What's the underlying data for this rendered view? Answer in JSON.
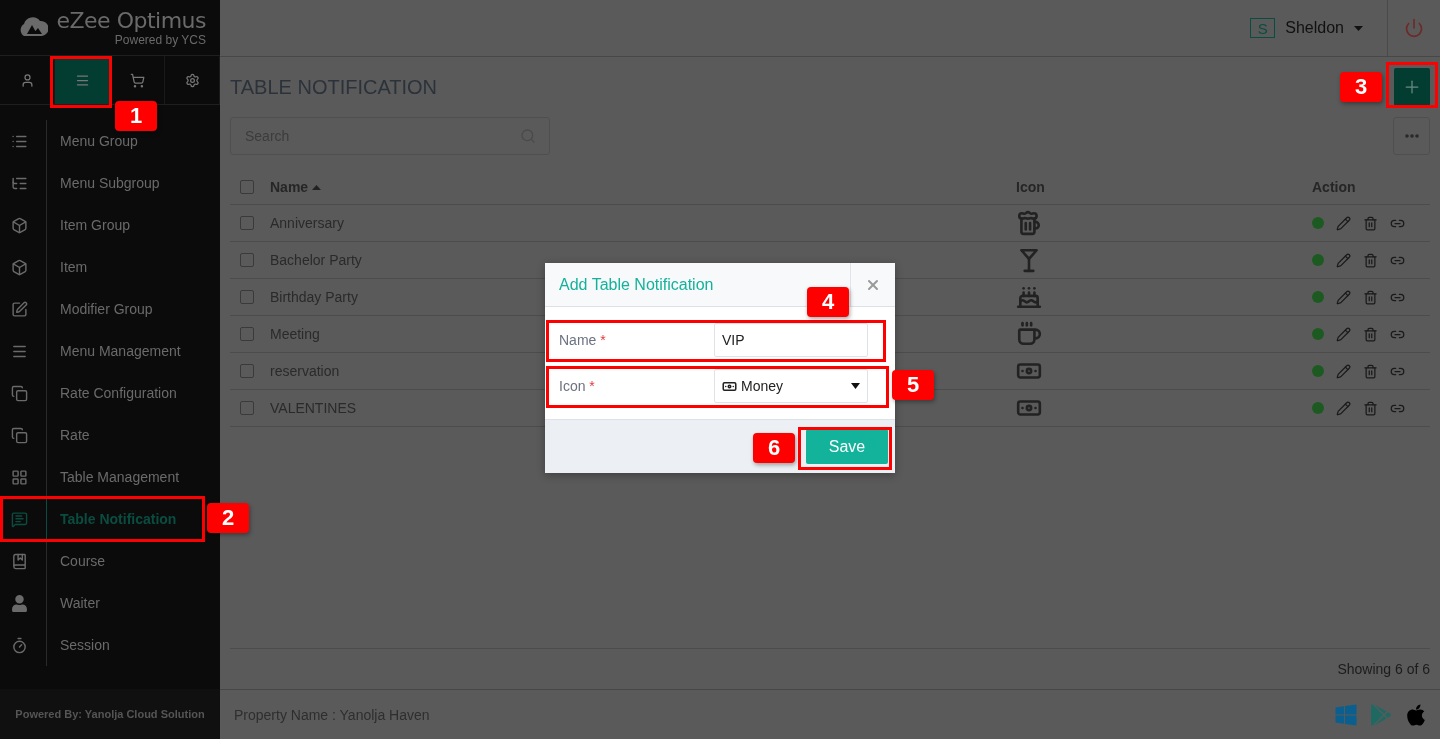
{
  "sidebar": {
    "logo": {
      "name": "eZee Optimus",
      "tagline": "Powered by YCS"
    },
    "tabs": [
      {
        "selected": false
      },
      {
        "selected": true
      },
      {
        "selected": false
      },
      {
        "selected": false
      }
    ],
    "items": [
      {
        "label": "Menu Group",
        "selected": false
      },
      {
        "label": "Menu Subgroup",
        "selected": false
      },
      {
        "label": "Item Group",
        "selected": false
      },
      {
        "label": "Item",
        "selected": false
      },
      {
        "label": "Modifier Group",
        "selected": false
      },
      {
        "label": "Menu Management",
        "selected": false
      },
      {
        "label": "Rate Configuration",
        "selected": false
      },
      {
        "label": "Rate",
        "selected": false
      },
      {
        "label": "Table Management",
        "selected": false
      },
      {
        "label": "Table Notification",
        "selected": true
      },
      {
        "label": "Course",
        "selected": false
      },
      {
        "label": "Waiter",
        "selected": false
      },
      {
        "label": "Session",
        "selected": false
      }
    ],
    "footer": "Powered By: Yanolja Cloud Solution"
  },
  "header": {
    "user_initial": "S",
    "user_name": "Sheldon"
  },
  "page": {
    "title": "TABLE NOTIFICATION",
    "search": {
      "placeholder": "Search"
    },
    "table": {
      "select_all_checked": false,
      "columns": [
        "Name",
        "Icon",
        "Action"
      ],
      "rows": [
        {
          "name": "Anniversary",
          "checked": false,
          "active": true
        },
        {
          "name": "Bachelor Party",
          "checked": false,
          "active": true
        },
        {
          "name": "Birthday Party",
          "checked": false,
          "active": true
        },
        {
          "name": "Meeting",
          "checked": false,
          "active": true
        },
        {
          "name": "reservation",
          "checked": false,
          "active": true
        },
        {
          "name": "VALENTINES",
          "checked": false,
          "active": true
        }
      ]
    },
    "count": "Showing 6 of 6"
  },
  "footer": {
    "property": "Property Name : Yanolja Haven"
  },
  "dialog": {
    "title": "Add Table Notification",
    "fields": [
      {
        "kind": "text",
        "label": "Name",
        "required": true,
        "required_mark": "*",
        "value": "VIP"
      },
      {
        "kind": "select",
        "label": "Icon",
        "required": true,
        "required_mark": "*",
        "value": "Money"
      }
    ],
    "button": "Save"
  },
  "annotations": [
    {
      "label": "1"
    },
    {
      "label": "2"
    },
    {
      "label": "3"
    },
    {
      "label": "4"
    },
    {
      "label": "5"
    },
    {
      "label": "6"
    }
  ]
}
